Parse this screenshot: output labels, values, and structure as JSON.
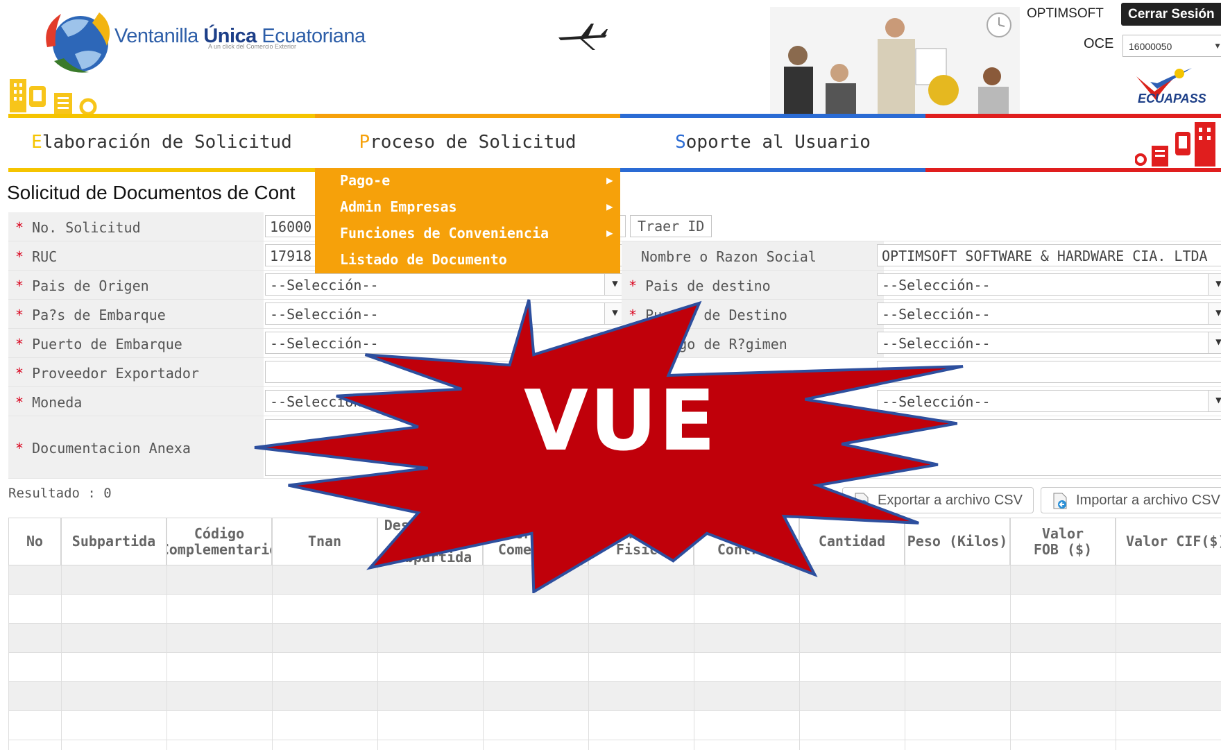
{
  "header": {
    "brand_regular": "Ventanilla ",
    "brand_bold": "Única",
    "brand_suffix": " Ecuatoriana",
    "tagline": "A un click del Comercio Exterior",
    "user_name": "OPTIMSOFT",
    "logout_label": "Cerrar Sesión",
    "oce_label": "OCE",
    "oce_value": "16000050",
    "ecuapass_label": "ECUAPASS"
  },
  "nav": {
    "tabs": [
      {
        "initial": "E",
        "rest": "laboración de Solicitud",
        "color": "#f5c400"
      },
      {
        "initial": "P",
        "rest": "roceso de Solicitud",
        "color": "#f6a10a"
      },
      {
        "initial": "S",
        "rest": "oporte al Usuario",
        "color": "#2a6bd4"
      }
    ],
    "dropdown": [
      "Pago-e",
      "Admin Empresas",
      "Funciones de Conveniencia",
      "Listado de Documento"
    ]
  },
  "page": {
    "title": "Solicitud de Documentos de Cont"
  },
  "form": {
    "required_mark": "*",
    "no_solicitud": {
      "label": "No. Solicitud",
      "value": "16000"
    },
    "traer_id": "Traer ID",
    "ruc": {
      "label": "RUC",
      "value": "17918"
    },
    "razon_social": {
      "label": "Nombre o Razon Social",
      "value": "OPTIMSOFT SOFTWARE & HARDWARE CIA. LTDA"
    },
    "pais_origen": {
      "label": "Pais de Origen",
      "value": "--Selección--"
    },
    "pais_destino": {
      "label": "Pais de destino",
      "value": "--Selección--"
    },
    "pais_embarque": {
      "label": "Pa?s de Embarque",
      "value": "--Selección--"
    },
    "puerto_destino": {
      "label": "Puerto de Destino",
      "value": "--Selección--"
    },
    "puerto_embarque": {
      "label": "Puerto de Embarque",
      "value": "--Selección--"
    },
    "regimen": {
      "label": "Código de R?gimen",
      "value": "--Selección--"
    },
    "proveedor": {
      "label": "Proveedor Exportador",
      "value": ""
    },
    "moneda": {
      "label": "Moneda",
      "value": "--Selección--"
    },
    "incoterm_value": "--Selección--",
    "documentacion": {
      "label": "Documentacion Anexa",
      "value": ""
    }
  },
  "results": {
    "label": "Resultado : 0",
    "export_csv": "Exportar a archivo CSV",
    "import_csv": "Importar a archivo CSV"
  },
  "table": {
    "columns": [
      "No",
      "Subpartida",
      "Código Complementario",
      "Tnan",
      "Descripcion de Subpartida",
      "Descripcion Comercial",
      "Unidad Fisica",
      "Entidad Control",
      "Cantidad",
      "Peso (Kilos)",
      "Valor FOB ($)",
      "Valor CIF($)"
    ],
    "rows": []
  },
  "overlay": {
    "text": "VUE",
    "fill": "#c0000a",
    "stroke": "#2d4f9e"
  }
}
